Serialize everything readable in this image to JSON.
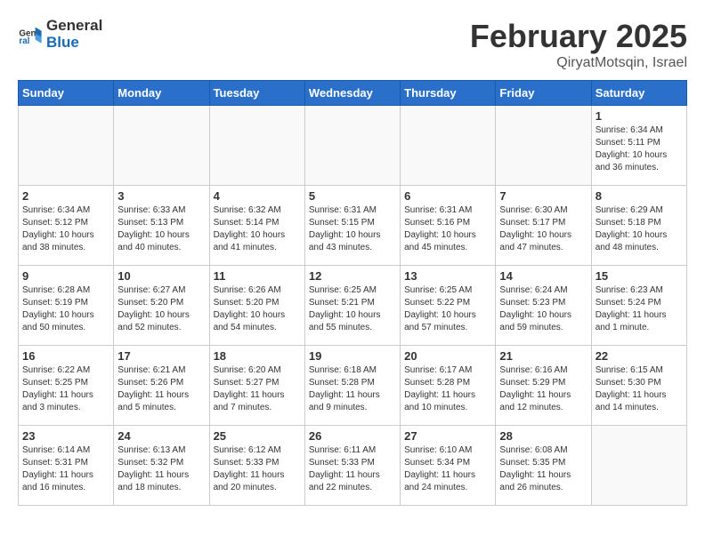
{
  "header": {
    "logo_general": "General",
    "logo_blue": "Blue",
    "title": "February 2025",
    "subtitle": "QiryatMotsqin, Israel"
  },
  "days_of_week": [
    "Sunday",
    "Monday",
    "Tuesday",
    "Wednesday",
    "Thursday",
    "Friday",
    "Saturday"
  ],
  "weeks": [
    [
      {
        "day": "",
        "info": ""
      },
      {
        "day": "",
        "info": ""
      },
      {
        "day": "",
        "info": ""
      },
      {
        "day": "",
        "info": ""
      },
      {
        "day": "",
        "info": ""
      },
      {
        "day": "",
        "info": ""
      },
      {
        "day": "1",
        "info": "Sunrise: 6:34 AM\nSunset: 5:11 PM\nDaylight: 10 hours and 36 minutes."
      }
    ],
    [
      {
        "day": "2",
        "info": "Sunrise: 6:34 AM\nSunset: 5:12 PM\nDaylight: 10 hours and 38 minutes."
      },
      {
        "day": "3",
        "info": "Sunrise: 6:33 AM\nSunset: 5:13 PM\nDaylight: 10 hours and 40 minutes."
      },
      {
        "day": "4",
        "info": "Sunrise: 6:32 AM\nSunset: 5:14 PM\nDaylight: 10 hours and 41 minutes."
      },
      {
        "day": "5",
        "info": "Sunrise: 6:31 AM\nSunset: 5:15 PM\nDaylight: 10 hours and 43 minutes."
      },
      {
        "day": "6",
        "info": "Sunrise: 6:31 AM\nSunset: 5:16 PM\nDaylight: 10 hours and 45 minutes."
      },
      {
        "day": "7",
        "info": "Sunrise: 6:30 AM\nSunset: 5:17 PM\nDaylight: 10 hours and 47 minutes."
      },
      {
        "day": "8",
        "info": "Sunrise: 6:29 AM\nSunset: 5:18 PM\nDaylight: 10 hours and 48 minutes."
      }
    ],
    [
      {
        "day": "9",
        "info": "Sunrise: 6:28 AM\nSunset: 5:19 PM\nDaylight: 10 hours and 50 minutes."
      },
      {
        "day": "10",
        "info": "Sunrise: 6:27 AM\nSunset: 5:20 PM\nDaylight: 10 hours and 52 minutes."
      },
      {
        "day": "11",
        "info": "Sunrise: 6:26 AM\nSunset: 5:20 PM\nDaylight: 10 hours and 54 minutes."
      },
      {
        "day": "12",
        "info": "Sunrise: 6:25 AM\nSunset: 5:21 PM\nDaylight: 10 hours and 55 minutes."
      },
      {
        "day": "13",
        "info": "Sunrise: 6:25 AM\nSunset: 5:22 PM\nDaylight: 10 hours and 57 minutes."
      },
      {
        "day": "14",
        "info": "Sunrise: 6:24 AM\nSunset: 5:23 PM\nDaylight: 10 hours and 59 minutes."
      },
      {
        "day": "15",
        "info": "Sunrise: 6:23 AM\nSunset: 5:24 PM\nDaylight: 11 hours and 1 minute."
      }
    ],
    [
      {
        "day": "16",
        "info": "Sunrise: 6:22 AM\nSunset: 5:25 PM\nDaylight: 11 hours and 3 minutes."
      },
      {
        "day": "17",
        "info": "Sunrise: 6:21 AM\nSunset: 5:26 PM\nDaylight: 11 hours and 5 minutes."
      },
      {
        "day": "18",
        "info": "Sunrise: 6:20 AM\nSunset: 5:27 PM\nDaylight: 11 hours and 7 minutes."
      },
      {
        "day": "19",
        "info": "Sunrise: 6:18 AM\nSunset: 5:28 PM\nDaylight: 11 hours and 9 minutes."
      },
      {
        "day": "20",
        "info": "Sunrise: 6:17 AM\nSunset: 5:28 PM\nDaylight: 11 hours and 10 minutes."
      },
      {
        "day": "21",
        "info": "Sunrise: 6:16 AM\nSunset: 5:29 PM\nDaylight: 11 hours and 12 minutes."
      },
      {
        "day": "22",
        "info": "Sunrise: 6:15 AM\nSunset: 5:30 PM\nDaylight: 11 hours and 14 minutes."
      }
    ],
    [
      {
        "day": "23",
        "info": "Sunrise: 6:14 AM\nSunset: 5:31 PM\nDaylight: 11 hours and 16 minutes."
      },
      {
        "day": "24",
        "info": "Sunrise: 6:13 AM\nSunset: 5:32 PM\nDaylight: 11 hours and 18 minutes."
      },
      {
        "day": "25",
        "info": "Sunrise: 6:12 AM\nSunset: 5:33 PM\nDaylight: 11 hours and 20 minutes."
      },
      {
        "day": "26",
        "info": "Sunrise: 6:11 AM\nSunset: 5:33 PM\nDaylight: 11 hours and 22 minutes."
      },
      {
        "day": "27",
        "info": "Sunrise: 6:10 AM\nSunset: 5:34 PM\nDaylight: 11 hours and 24 minutes."
      },
      {
        "day": "28",
        "info": "Sunrise: 6:08 AM\nSunset: 5:35 PM\nDaylight: 11 hours and 26 minutes."
      },
      {
        "day": "",
        "info": ""
      }
    ]
  ]
}
